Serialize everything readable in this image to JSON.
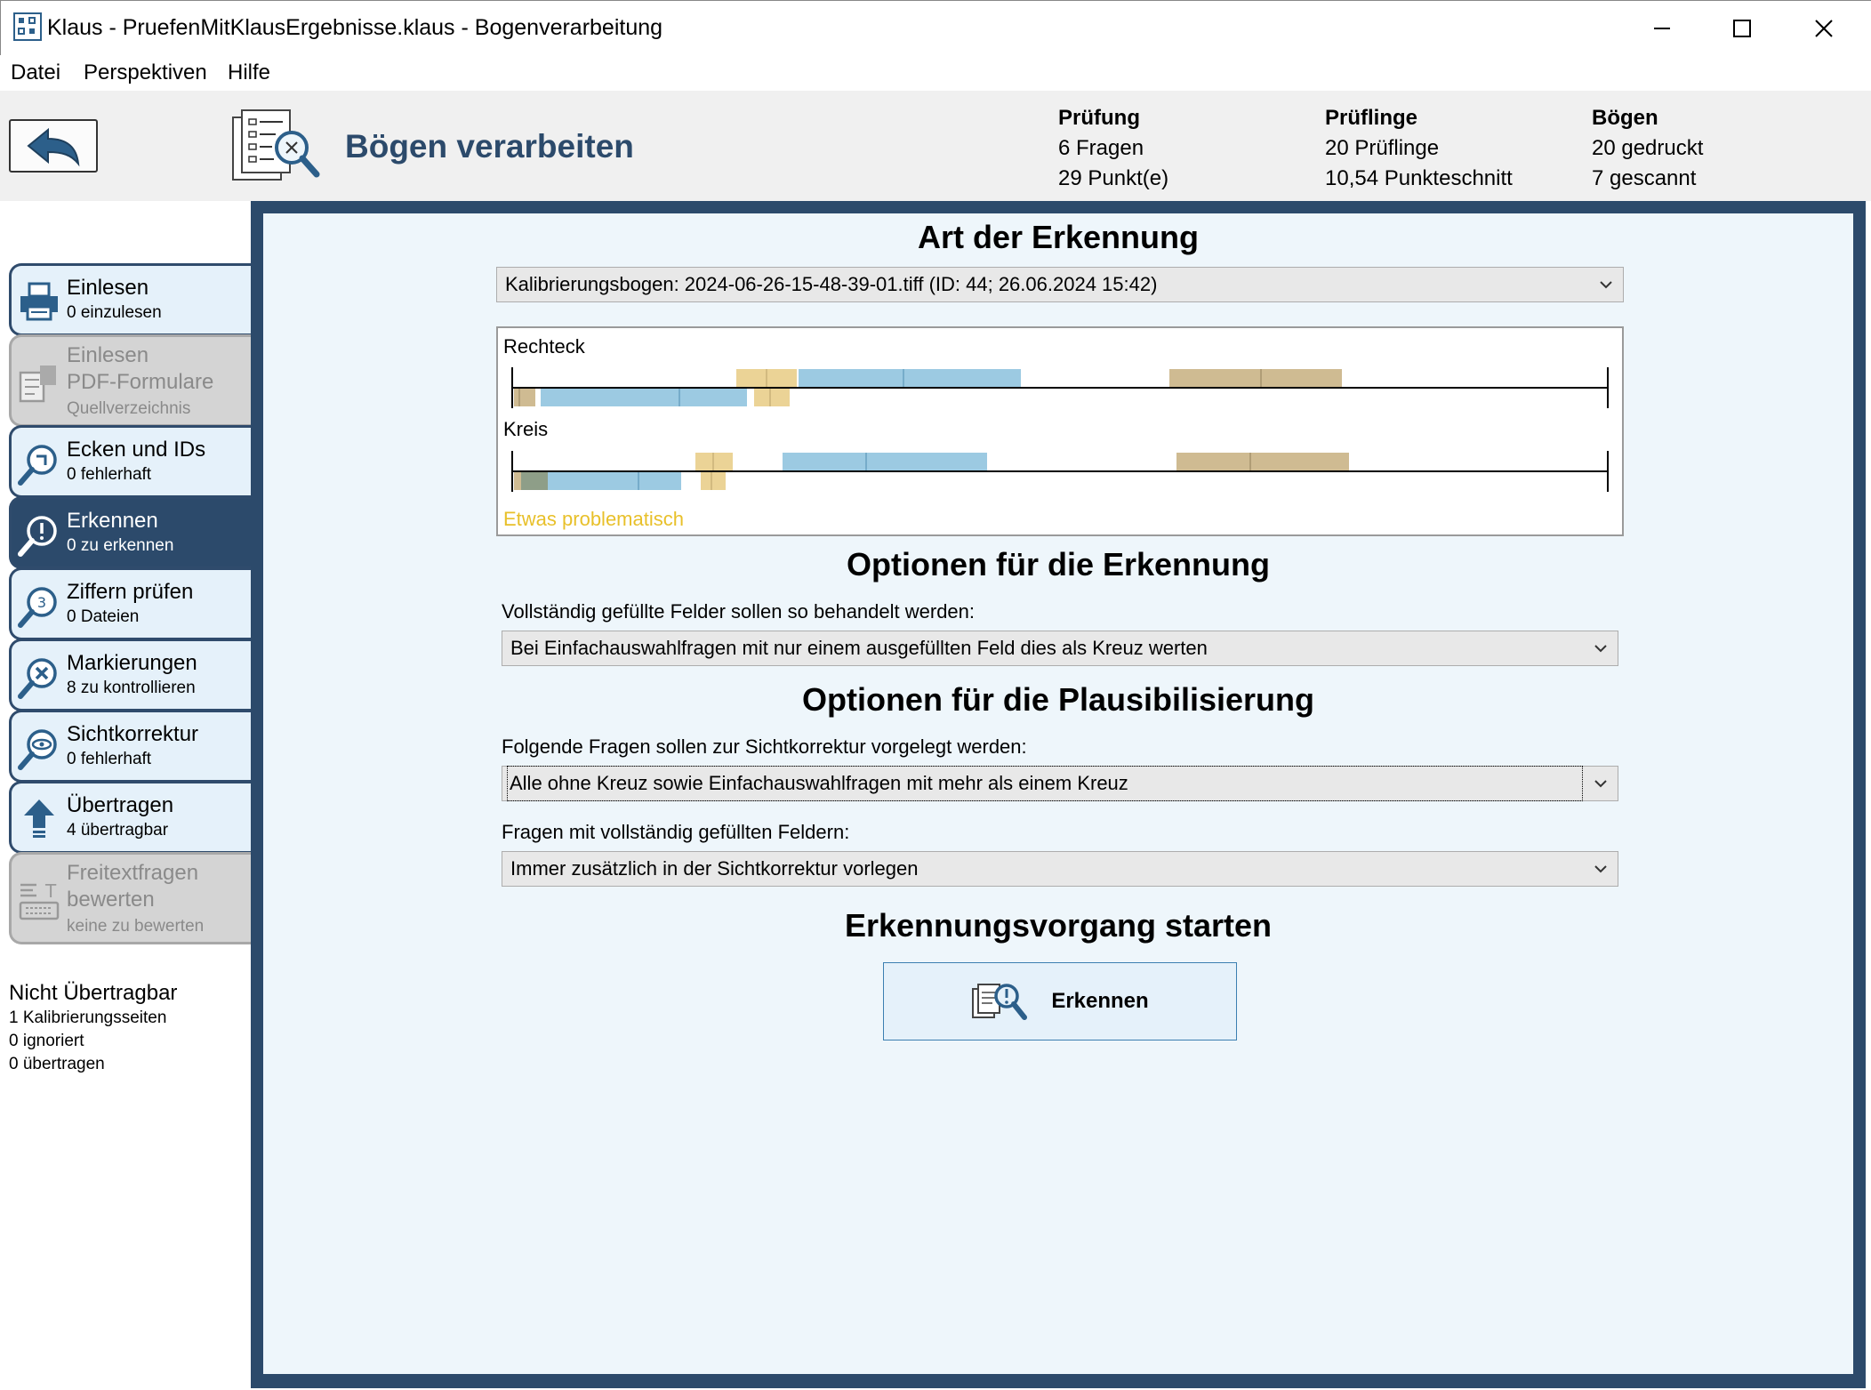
{
  "window": {
    "title": "Klaus - PruefenMitKlausErgebnisse.klaus - Bogenverarbeitung"
  },
  "menu": {
    "items": [
      "Datei",
      "Perspektiven",
      "Hilfe"
    ]
  },
  "header": {
    "title": "Bögen verarbeiten",
    "stats": {
      "pruefung": {
        "head": "Prüfung",
        "line1": "6 Fragen",
        "line2": "29 Punkt(e)"
      },
      "prueflinge": {
        "head": "Prüflinge",
        "line1": "20 Prüflinge",
        "line2": "10,54 Punkteschnitt"
      },
      "boegen": {
        "head": "Bögen",
        "line1": "20 gedruckt",
        "line2": "7 gescannt"
      }
    }
  },
  "nav": {
    "items": [
      {
        "title": "Einlesen",
        "sub": "0 einzulesen",
        "icon": "printer-icon",
        "state": "normal"
      },
      {
        "title": "Einlesen PDF-Formulare",
        "title_line1": "Einlesen",
        "title_line2": "PDF-Formulare",
        "sub": "Quellverzeichnis",
        "icon": "pdf-form-icon",
        "state": "disabled"
      },
      {
        "title": "Ecken und IDs",
        "sub": "0 fehlerhaft",
        "icon": "magnifier-corner-icon",
        "state": "normal"
      },
      {
        "title": "Erkennen",
        "sub": "0 zu erkennen",
        "icon": "magnifier-exclamation-icon",
        "state": "active"
      },
      {
        "title": "Ziffern prüfen",
        "sub": "0 Dateien",
        "icon": "magnifier-digit-icon",
        "state": "normal"
      },
      {
        "title": "Markierungen",
        "sub": "8 zu kontrollieren",
        "icon": "magnifier-x-icon",
        "state": "normal"
      },
      {
        "title": "Sichtkorrektur",
        "sub": "0 fehlerhaft",
        "icon": "magnifier-eye-icon",
        "state": "normal"
      },
      {
        "title": "Übertragen",
        "sub": "4 übertragbar",
        "icon": "upload-arrow-icon",
        "state": "normal"
      },
      {
        "title": "Freitextfragen bewerten",
        "title_line1": "Freitextfragen",
        "title_line2": "bewerten",
        "sub": "keine zu bewerten",
        "icon": "keyboard-text-icon",
        "state": "disabled"
      }
    ],
    "not_transferable": {
      "title": "Nicht Übertragbar",
      "lines": [
        "1 Kalibrierungsseiten",
        "0 ignoriert",
        "0 übertragen"
      ]
    }
  },
  "main": {
    "section1_title": "Art der Erkennung",
    "calibration_select": "Kalibrierungsbogen: 2024-06-26-15-48-39-01.tiff (ID: 44; 26.06.2024 15:42)",
    "calibration": {
      "row1_label": "Rechteck",
      "row2_label": "Kreis",
      "warning": "Etwas problematisch",
      "colors": {
        "blue": "#9ccae2",
        "yellow": "#ebd396",
        "tan": "#cfbb92",
        "gray": "#8e9e88",
        "warning": "#e8c02a"
      }
    },
    "section2_title": "Optionen für die Erkennung",
    "filled_label": "Vollständig gefüllte Felder sollen so behandelt werden:",
    "filled_select": "Bei Einfachauswahlfragen mit nur einem ausgefüllten Feld dies als Kreuz werten",
    "section3_title": "Optionen für die Plausibilisierung",
    "review_label": "Folgende Fragen sollen zur Sichtkorrektur vorgelegt werden:",
    "review_select": "Alle ohne Kreuz sowie Einfachauswahlfragen mit mehr als einem Kreuz",
    "full_label": "Fragen mit vollständig gefüllten Feldern:",
    "full_select": "Immer zusätzlich in der Sichtkorrektur vorlegen",
    "section4_title": "Erkennungsvorgang starten",
    "start_button": "Erkennen"
  },
  "theme": {
    "accent": "#2c4a6b",
    "nav_bg": "#e5f1fa",
    "main_bg": "#eef6fb"
  }
}
